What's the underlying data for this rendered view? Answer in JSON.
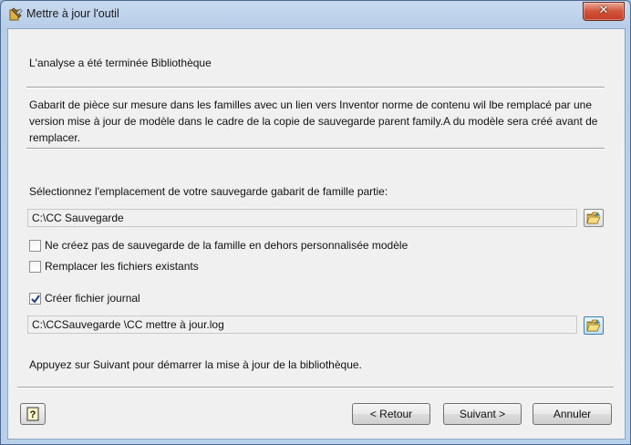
{
  "window": {
    "title": "Mettre à jour l'outil",
    "close_label": "✕"
  },
  "status": "L'analyse a été terminée Bibliothèque",
  "description": "Gabarit de pièce sur mesure dans les familles avec un lien vers Inventor norme de contenu wil lbe remplacé par une version mise à jour de modèle dans le cadre de la copie de sauvegarde parent family.A du modèle sera créé avant de remplacer.",
  "backup": {
    "label": "Sélectionnez l'emplacement de votre sauvegarde gabarit de famille partie:",
    "path": "C:\\CC Sauvegarde"
  },
  "options": [
    {
      "label": "Ne créez pas de sauvegarde de la famille en dehors personnalisée modèle",
      "checked": false
    },
    {
      "label": "Remplacer les fichiers existants",
      "checked": false
    }
  ],
  "log": {
    "label": "Créer fichier journal",
    "checked": true,
    "path": "C:\\CCSauvegarde \\CC mettre à jour.log"
  },
  "instruction": "Appuyez sur Suivant pour démarrer la mise à jour de la bibliothèque.",
  "buttons": {
    "help": "?",
    "back": "< Retour",
    "next": "Suivant >",
    "cancel": "Annuler"
  }
}
